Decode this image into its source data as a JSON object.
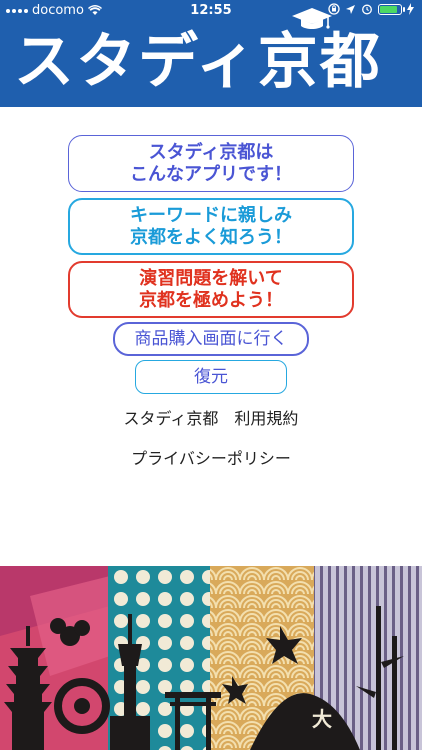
{
  "status_bar": {
    "carrier": "docomo",
    "time": "12:55"
  },
  "header": {
    "logo_text": "スタディ京都",
    "logo_icon": "graduation-cap-icon"
  },
  "menu": {
    "about_label": "スタディ京都は\nこんなアプリです！",
    "keyword_label": "キーワードに親しみ\n京都をよく知ろう！",
    "exercise_label": "演習問題を解いて\n京都を極めよう！",
    "purchase_label": "商品購入画面に行く",
    "restore_label": "復元",
    "terms_label": "スタディ京都　利用規約",
    "privacy_label": "プライバシーポリシー"
  },
  "colors": {
    "brand_blue": "#1f5fae",
    "accent_purple": "#4a55d4",
    "accent_cyan": "#1a9bd8",
    "accent_red": "#e0321f"
  }
}
